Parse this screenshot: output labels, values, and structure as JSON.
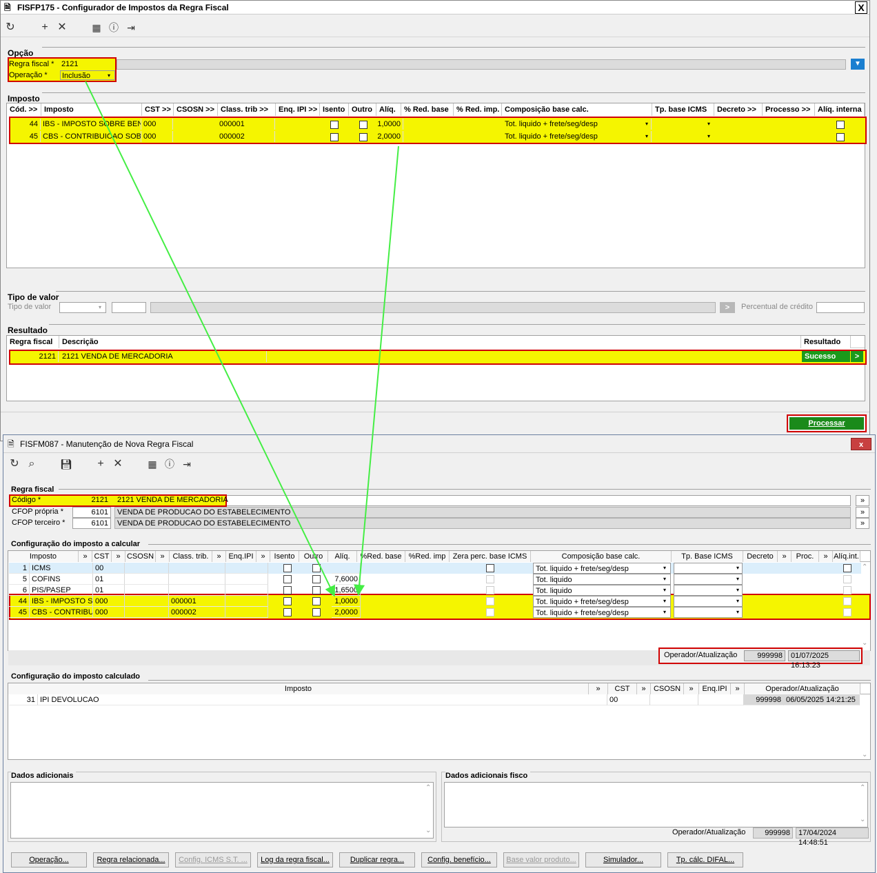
{
  "win1": {
    "title": "FISFP175 - Configurador de Impostos da Regra Fiscal",
    "close": "X",
    "opcao": {
      "section": "Opção",
      "regra_label": "Regra fiscal *",
      "regra_value": "2121",
      "operacao_label": "Operação *",
      "operacao_value": "Inclusão"
    },
    "imposto": {
      "section": "Imposto",
      "headers": [
        "Cód. >>",
        "Imposto",
        "CST >>",
        "CSOSN >>",
        "Class. trib >>",
        "Enq. IPI >>",
        "Isento",
        "Outro",
        "Alíq.",
        "% Red. base",
        "% Red. imp.",
        "Composição base calc.",
        "Tp. base ICMS",
        "Decreto >>",
        "Processo >>",
        "Alíq. interna"
      ],
      "rows": [
        {
          "cod": "44",
          "imposto": "IBS - IMPOSTO SOBRE BENS",
          "cst": "000",
          "class": "000001",
          "aliq": "1,0000",
          "comp": "Tot. liquido + frete/seg/desp"
        },
        {
          "cod": "45",
          "imposto": "CBS - CONTRIBUICAO SOBRI",
          "cst": "000",
          "class": "000002",
          "aliq": "2,0000",
          "comp": "Tot. liquido + frete/seg/desp"
        }
      ]
    },
    "tipo": {
      "section": "Tipo de valor",
      "label": "Tipo de valor",
      "perc_label": "Percentual de crédito",
      "arrow": ">"
    },
    "resultado": {
      "section": "Resultado",
      "headers": [
        "Regra fiscal",
        "Descrição",
        "Resultado"
      ],
      "row": {
        "regra": "2121",
        "descricao": "2121 VENDA DE MERCADORIA",
        "resultado": "Sucesso",
        "go": ">"
      }
    },
    "processar": "Processar"
  },
  "win2": {
    "title": "FISFM087 - Manutenção de Nova Regra Fiscal",
    "close": "x",
    "regra": {
      "section": "Regra fiscal",
      "codigo_label": "Código *",
      "codigo_value": "2121",
      "codigo_desc": "2121 VENDA DE MERCADORIA",
      "cfop_propria_label": "CFOP própria *",
      "cfop_propria_value": "6101",
      "cfop_propria_desc": "VENDA DE PRODUCAO DO ESTABELECIMENTO",
      "cfop_terceiro_label": "CFOP terceiro *",
      "cfop_terceiro_value": "6101",
      "cfop_terceiro_desc": "VENDA DE PRODUCAO DO ESTABELECIMENTO",
      "more": "»"
    },
    "calcular": {
      "section": "Configuração do imposto a calcular",
      "headers": [
        "Imposto",
        "»",
        "CST",
        "»",
        "CSOSN",
        "»",
        "Class. trib.",
        "»",
        "Enq.IPI",
        "»",
        "Isento",
        "Outro",
        "Alíq.",
        "%Red. base",
        "%Red. imp",
        "Zera perc. base ICMS",
        "Composição base calc.",
        "Tp. Base ICMS",
        "Decreto",
        "»",
        "Proc.",
        "»",
        "Alíq.int."
      ],
      "rows": [
        {
          "cod": "1",
          "imposto": "ICMS",
          "cst": "00",
          "class": "",
          "aliq": "",
          "comp": "Tot. liquido + frete/seg/desp"
        },
        {
          "cod": "5",
          "imposto": "COFINS",
          "cst": "01",
          "class": "",
          "aliq": "7,6000",
          "comp": "Tot. liquido"
        },
        {
          "cod": "6",
          "imposto": "PIS/PASEP",
          "cst": "01",
          "class": "",
          "aliq": "1,6500",
          "comp": "Tot. liquido"
        },
        {
          "cod": "44",
          "imposto": "IBS - IMPOSTO SOBRE",
          "cst": "000",
          "class": "000001",
          "aliq": "1,0000",
          "comp": "Tot. liquido + frete/seg/desp"
        },
        {
          "cod": "45",
          "imposto": "CBS - CONTRIBUICAO",
          "cst": "000",
          "class": "000002",
          "aliq": "2,0000",
          "comp": "Tot. liquido + frete/seg/desp"
        }
      ],
      "oper_label": "Operador/Atualização",
      "oper_user": "999998",
      "oper_date": "01/07/2025 16:13:23"
    },
    "calculado": {
      "section": "Configuração do imposto calculado",
      "headers": [
        "Imposto",
        "»",
        "CST",
        "»",
        "CSOSN",
        "»",
        "Enq.IPI",
        "»",
        "Operador/Atualização"
      ],
      "row": {
        "cod": "31",
        "imposto": "IPI DEVOLUCAO",
        "cst": "00",
        "user": "999998",
        "date": "06/05/2025 14:21:25"
      }
    },
    "adicionais": {
      "dados_label": "Dados adicionais",
      "fisco_label": "Dados adicionais fisco",
      "oper_label": "Operador/Atualização",
      "oper_user": "999998",
      "oper_date": "17/04/2024 14:48:51"
    },
    "buttons": [
      "Operação...",
      "Regra relacionada...",
      "Config. ICMS S.T. ...",
      "Log da regra fiscal...",
      "Duplicar regra...",
      "Config. benefício...",
      "Base valor produto...",
      "Simulador...",
      "Tp. cálc. DIFAL..."
    ]
  },
  "colors": {
    "highlight": "#f5f500",
    "annotation": "#d00000",
    "arrow": "#44ee44",
    "success": "#1a9a1a"
  }
}
